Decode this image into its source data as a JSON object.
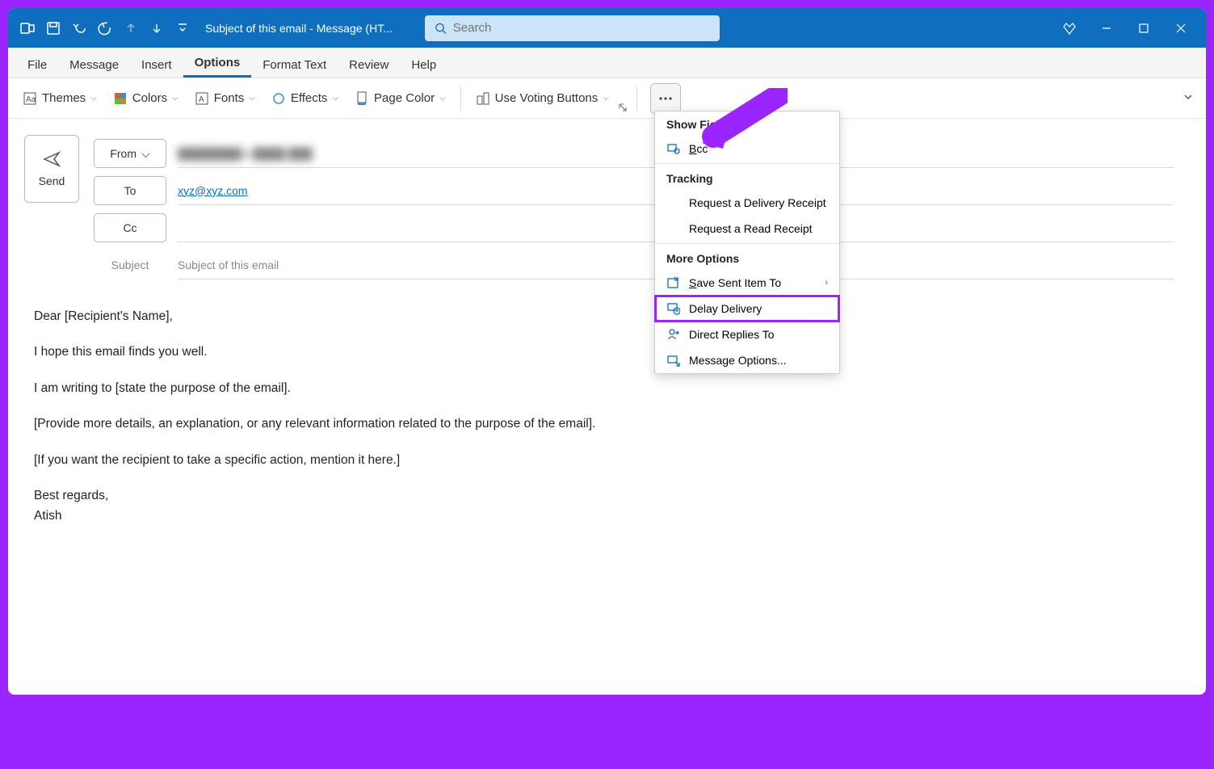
{
  "titlebar": {
    "title": "Subject of this email  -  Message (HT...",
    "search_placeholder": "Search"
  },
  "tabs": {
    "file": "File",
    "message": "Message",
    "insert": "Insert",
    "options": "Options",
    "format_text": "Format Text",
    "review": "Review",
    "help": "Help"
  },
  "ribbon": {
    "themes": "Themes",
    "colors": "Colors",
    "fonts": "Fonts",
    "effects": "Effects",
    "page_color": "Page Color",
    "voting": "Use Voting Buttons"
  },
  "compose": {
    "send": "Send",
    "from_label": "From",
    "to_label": "To",
    "cc_label": "Cc",
    "subject_label": "Subject",
    "to_value": "xyz@xyz.com",
    "subject_value": "Subject of this email"
  },
  "body": {
    "p1": "Dear [Recipient's Name],",
    "p2": "I hope this email finds you well.",
    "p3": "I am writing to [state the purpose of the email].",
    "p4": "[Provide more details, an explanation, or any relevant information related to the purpose of the email].",
    "p5": "[If you want the recipient to take a specific action, mention it here.]",
    "p6": "Best regards,",
    "p7": "Atish"
  },
  "dropdown": {
    "section1": "Show Fields",
    "bcc_pre": "B",
    "bcc_post": "cc",
    "section2": "Tracking",
    "req_delivery": "Request a Delivery Receipt",
    "req_read": "Request a Read Receipt",
    "section3": "More Options",
    "save_sent_pre": "S",
    "save_sent_post": "ave Sent Item To",
    "delay": "Delay Delivery",
    "direct_replies": "Direct Replies To",
    "msg_options": "Message Options..."
  }
}
